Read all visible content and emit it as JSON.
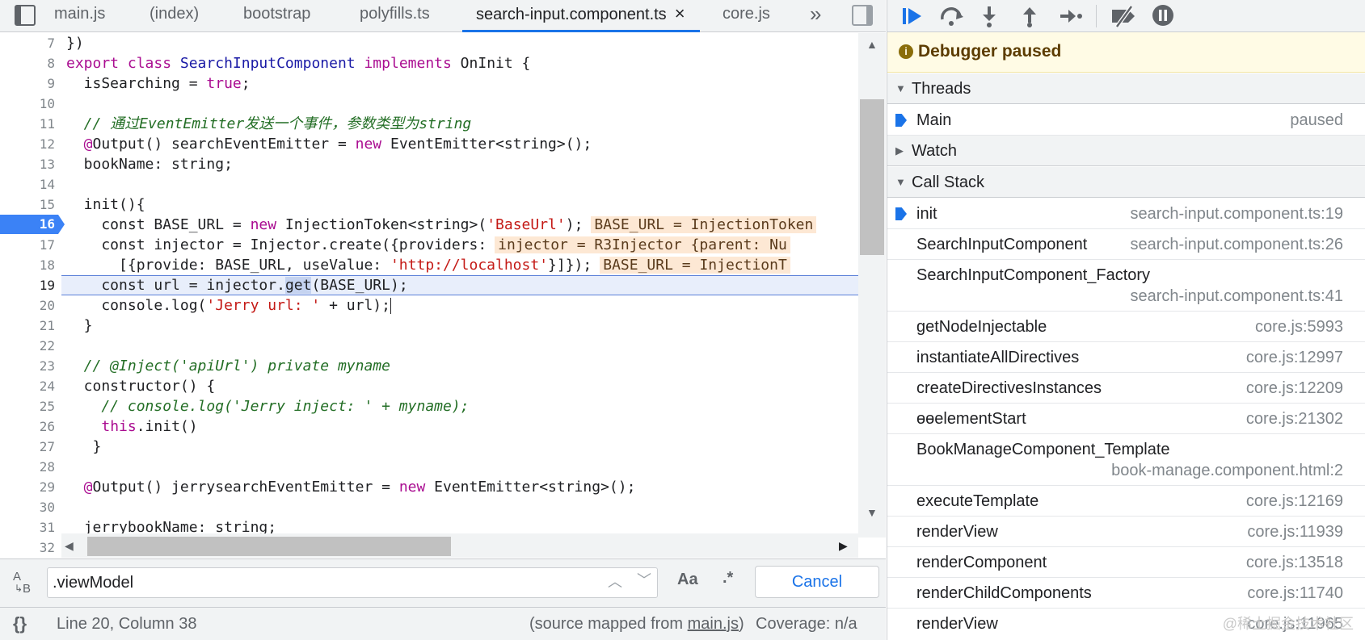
{
  "tabs": [
    {
      "label": "main.js"
    },
    {
      "label": "(index)"
    },
    {
      "label": "bootstrap"
    },
    {
      "label": "polyfills.ts"
    },
    {
      "label": "search-input.component.ts",
      "active": true
    },
    {
      "label": "core.js"
    }
  ],
  "tab_close_symbol": "×",
  "overflow_symbol": "»",
  "line_numbers": [
    "7",
    "8",
    "9",
    "10",
    "11",
    "12",
    "13",
    "14",
    "15",
    "16",
    "17",
    "18",
    "19",
    "20",
    "21",
    "22",
    "23",
    "24",
    "25",
    "26",
    "27",
    "28",
    "29",
    "30",
    "31",
    "32"
  ],
  "breakpoint_line": "16",
  "code": {
    "l7": "})",
    "l8_kw": "export class",
    "l8_cls": " SearchInputComponent ",
    "l8_impl": "implements",
    "l8_rest": " OnInit {",
    "l9_a": "  isSearching = ",
    "l9_b": "true",
    "l9_c": ";",
    "l11": "  // 通过EventEmitter发送一个事件，参数类型为string",
    "l12_a": "  @",
    "l12_b": "Output() searchEventEmitter = ",
    "l12_c": "new",
    "l12_d": " EventEmitter<string>();",
    "l13": "  bookName: string;",
    "l15": "  init(){",
    "l16_a": "    const BASE_URL = ",
    "l16_b": "new",
    "l16_c": " InjectionToken<string>(",
    "l16_d": "'BaseUrl'",
    "l16_e": ");",
    "l16_inline": "BASE_URL = InjectionToken",
    "l17_a": "    const injector = Injector.create({providers:",
    "l17_inline": "injector = R3Injector {parent: Nu",
    "l18_a": "      [{provide: BASE_URL, useValue: ",
    "l18_b": "'http://localhost'",
    "l18_c": "}]});",
    "l18_inline": "BASE_URL = InjectionT",
    "l19_a": "    const url = injector.",
    "l19_b": "get",
    "l19_c": "(BASE_URL);",
    "l20_a": "    console.log(",
    "l20_b": "'Jerry url: '",
    "l20_c": " + url);",
    "l21": "  }",
    "l23": "  // @Inject('apiUrl') private myname",
    "l24": "  constructor() {",
    "l25": "    // console.log('Jerry inject: ' + myname);",
    "l26_a": "    ",
    "l26_b": "this",
    "l26_c": ".init()",
    "l27": "   }",
    "l29_a": "  @",
    "l29_b": "Output() jerrysearchEventEmitter = ",
    "l29_c": "new",
    "l29_d": " EventEmitter<string>();",
    "l31": "  jerrybookName: string;"
  },
  "search": {
    "value": ".viewModel",
    "case_label": "Aa",
    "regex_label": ".*",
    "cancel_label": "Cancel"
  },
  "status": {
    "position": "Line 20, Column 38",
    "source_prefix": "(source mapped from ",
    "source_link": "main.js",
    "source_suffix": ")",
    "coverage": "Coverage: n/a",
    "pretty_print": "{}"
  },
  "debugger": {
    "banner": "Debugger paused",
    "threads_label": "Threads",
    "thread_name": "Main",
    "thread_status": "paused",
    "watch_label": "Watch",
    "callstack_label": "Call Stack",
    "frames": [
      {
        "fn": "init",
        "loc": "search-input.component.ts:19"
      },
      {
        "fn": "SearchInputComponent",
        "loc": "search-input.component.ts:26"
      },
      {
        "fn": "SearchInputComponent_Factory",
        "loc": "search-input.component.ts:41"
      },
      {
        "fn": "getNodeInjectable",
        "loc": "core.js:5993"
      },
      {
        "fn": "instantiateAllDirectives",
        "loc": "core.js:12997"
      },
      {
        "fn": "createDirectivesInstances",
        "loc": "core.js:12209"
      },
      {
        "fn": "ɵɵelementStart",
        "loc": "core.js:21302"
      },
      {
        "fn": "BookManageComponent_Template",
        "loc": "book-manage.component.html:2"
      },
      {
        "fn": "executeTemplate",
        "loc": "core.js:12169"
      },
      {
        "fn": "renderView",
        "loc": "core.js:11939"
      },
      {
        "fn": "renderComponent",
        "loc": "core.js:13518"
      },
      {
        "fn": "renderChildComponents",
        "loc": "core.js:11740"
      },
      {
        "fn": "renderView",
        "loc": "core.js:11965"
      }
    ]
  },
  "watermark": "@稀土掘金技术社区",
  "colors": {
    "accent": "#1a73e8",
    "breakpoint": "#3b82f6",
    "keyword": "#aa0d91",
    "string": "#c41a16",
    "comment": "#236e25"
  }
}
